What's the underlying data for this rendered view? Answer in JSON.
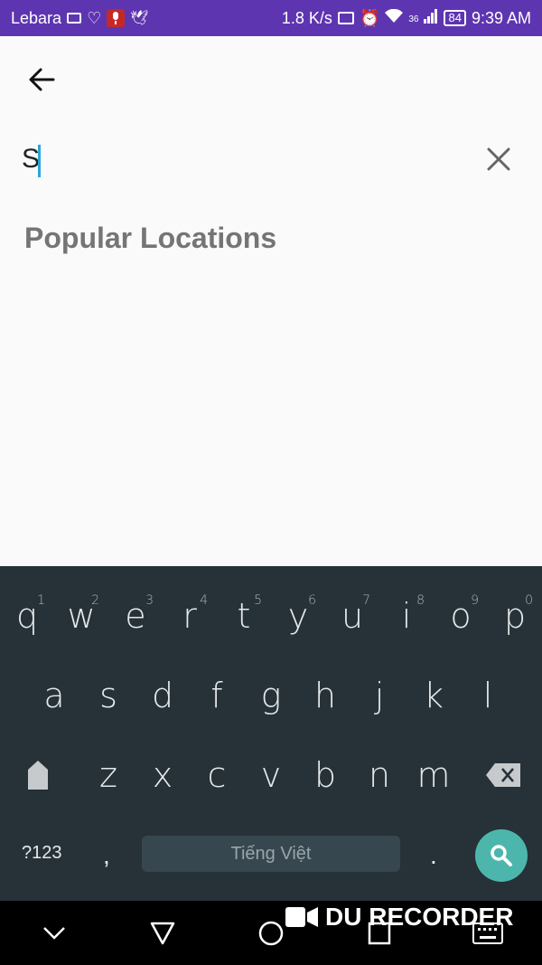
{
  "status_bar": {
    "carrier": "Lebara",
    "speed": "1.8 K/s",
    "network": "36",
    "battery": "84",
    "time": "9:39 AM",
    "color": "#5e35b1"
  },
  "search": {
    "query": "S",
    "placeholder": ""
  },
  "section_title": "Popular Locations",
  "keyboard": {
    "row1": [
      {
        "key": "q",
        "hint": "1"
      },
      {
        "key": "w",
        "hint": "2"
      },
      {
        "key": "e",
        "hint": "3"
      },
      {
        "key": "r",
        "hint": "4"
      },
      {
        "key": "t",
        "hint": "5"
      },
      {
        "key": "y",
        "hint": "6"
      },
      {
        "key": "u",
        "hint": "7"
      },
      {
        "key": "i",
        "hint": "8"
      },
      {
        "key": "o",
        "hint": "9"
      },
      {
        "key": "p",
        "hint": "0"
      }
    ],
    "row2": [
      "a",
      "s",
      "d",
      "f",
      "g",
      "h",
      "j",
      "k",
      "l"
    ],
    "row3": [
      "z",
      "x",
      "c",
      "v",
      "b",
      "n",
      "m"
    ],
    "symbols_label": "?123",
    "comma": ",",
    "period": ".",
    "space_label": "Tiếng Việt",
    "accent_color": "#4db6ac",
    "background_color": "#263238"
  },
  "watermark": "DU RECORDER",
  "icons": {
    "back": "arrow-left-icon",
    "clear": "close-icon",
    "shift": "shift-icon",
    "backspace": "backspace-icon",
    "search": "search-icon",
    "nav_hide": "chevron-down-icon",
    "nav_back": "triangle-back-icon",
    "nav_home": "circle-home-icon",
    "nav_recents": "square-recents-icon",
    "nav_keyboard": "keyboard-icon"
  }
}
